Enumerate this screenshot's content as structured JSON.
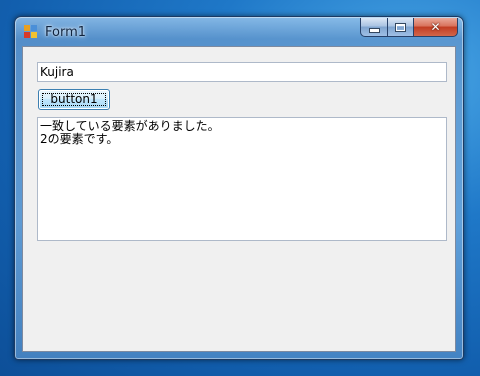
{
  "window": {
    "title": "Form1",
    "close_symbol": "✕"
  },
  "form": {
    "textbox_value": "Kujira",
    "button_label": "button1",
    "output_lines": [
      "一致している要素がありました。",
      "2の要素です。"
    ]
  },
  "icons": {
    "app": "windows-form-icon",
    "minimize": "minimize-icon",
    "maximize": "maximize-icon",
    "close": "close-icon"
  },
  "colors": {
    "client_bg": "#f0f0f0",
    "close_red": "#c13c22",
    "desktop_blue": "#1f78c8"
  }
}
